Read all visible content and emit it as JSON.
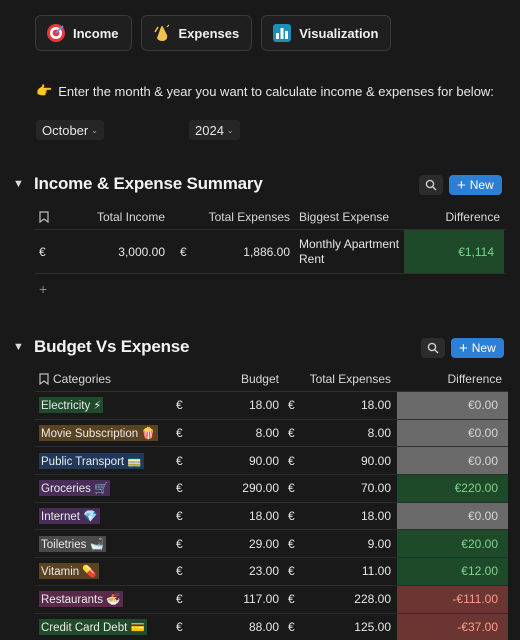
{
  "nav": [
    {
      "label": "Income",
      "icon": "target-icon"
    },
    {
      "label": "Expenses",
      "icon": "clapping-hands-icon"
    },
    {
      "label": "Visualization",
      "icon": "bar-chart-icon"
    }
  ],
  "prompt": {
    "emoji": "👉",
    "text": "Enter the month & year you want to calculate income & expenses for below:"
  },
  "month": "October",
  "year": "2024",
  "summary": {
    "title": "Income & Expense Summary",
    "new_label": "New",
    "columns": [
      "Total Income",
      "Total Expenses",
      "Biggest Expense",
      "Difference"
    ],
    "row": {
      "income_currency": "€",
      "income": "3,000.00",
      "expense_currency": "€",
      "expenses": "1,886.00",
      "biggest_expense": "Monthly Apartment Rent",
      "difference": "€1,114"
    },
    "add_label": "+"
  },
  "budget": {
    "title": "Budget Vs Expense",
    "new_label": "New",
    "columns": [
      "Categories",
      "Budget",
      "Total Expenses",
      "Difference"
    ],
    "rows": [
      {
        "category": "Electricity ⚡",
        "tag_color": "#1f4a2c",
        "budget_currency": "€",
        "budget": "18.00",
        "expense_currency": "€",
        "expenses": "18.00",
        "difference": "€0.00",
        "status": "neutral"
      },
      {
        "category": "Movie Subscription 🍿",
        "tag_color": "#5a4322",
        "budget_currency": "€",
        "budget": "8.00",
        "expense_currency": "€",
        "expenses": "8.00",
        "difference": "€0.00",
        "status": "neutral"
      },
      {
        "category": "Public Transport 🚃",
        "tag_color": "#22385a",
        "budget_currency": "€",
        "budget": "90.00",
        "expense_currency": "€",
        "expenses": "90.00",
        "difference": "€0.00",
        "status": "neutral"
      },
      {
        "category": "Groceries 🛒",
        "tag_color": "#4a2e5a",
        "budget_currency": "€",
        "budget": "290.00",
        "expense_currency": "€",
        "expenses": "70.00",
        "difference": "€220.00",
        "status": "pos"
      },
      {
        "category": "Internet 💎",
        "tag_color": "#4a2e5a",
        "budget_currency": "€",
        "budget": "18.00",
        "expense_currency": "€",
        "expenses": "18.00",
        "difference": "€0.00",
        "status": "neutral"
      },
      {
        "category": "Toiletries 🛁",
        "tag_color": "#4a4a4a",
        "budget_currency": "€",
        "budget": "29.00",
        "expense_currency": "€",
        "expenses": "9.00",
        "difference": "€20.00",
        "status": "pos"
      },
      {
        "category": "Vitamin 💊",
        "tag_color": "#5a4322",
        "budget_currency": "€",
        "budget": "23.00",
        "expense_currency": "€",
        "expenses": "11.00",
        "difference": "€12.00",
        "status": "pos"
      },
      {
        "category": "Restaurants 🍜",
        "tag_color": "#5a2a4a",
        "budget_currency": "€",
        "budget": "117.00",
        "expense_currency": "€",
        "expenses": "228.00",
        "difference": "-€111.00",
        "status": "neg"
      },
      {
        "category": "Credit Card Debt 💳",
        "tag_color": "#1f4a2c",
        "budget_currency": "€",
        "budget": "88.00",
        "expense_currency": "€",
        "expenses": "125.00",
        "difference": "-€37.00",
        "status": "neg"
      }
    ]
  }
}
